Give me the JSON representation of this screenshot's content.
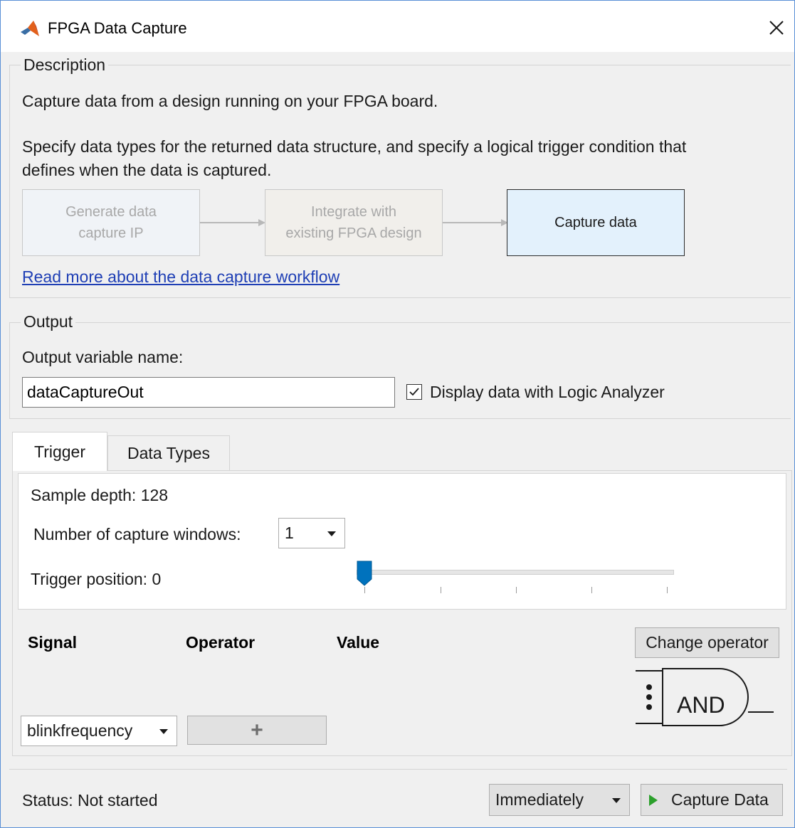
{
  "window": {
    "title": "FPGA Data Capture",
    "close_label": "×"
  },
  "description": {
    "group_label": "Description",
    "line1": "Capture data from a design running on your FPGA board.",
    "line2": "Specify data types for the returned data structure, and specify a logical trigger condition that",
    "line3": "defines when the data is captured.",
    "flow": [
      {
        "line1": "Generate data",
        "line2": "capture IP"
      },
      {
        "line1": "Integrate with",
        "line2": "existing FPGA design"
      },
      {
        "line1": "Capture data",
        "line2": ""
      }
    ],
    "link": "Read more about the data capture workflow"
  },
  "output": {
    "group_label": "Output",
    "var_label": "Output variable name:",
    "var_value": "dataCaptureOut",
    "checkbox_label": "Display data with Logic Analyzer",
    "checkbox_checked": true
  },
  "tabs": [
    {
      "label": "Trigger",
      "active": true
    },
    {
      "label": "Data Types",
      "active": false
    }
  ],
  "trigger": {
    "sample_depth": "Sample depth: 128",
    "windows_label": "Number of capture windows:",
    "windows_value": "1",
    "position_label": "Trigger position: 0",
    "position_value": 0,
    "table_headers": {
      "signal": "Signal",
      "operator": "Operator",
      "value": "Value"
    },
    "signal_select": "blinkfrequency",
    "add_label": "+",
    "change_operator_label": "Change operator",
    "gate_label": "AND"
  },
  "status": {
    "text": "Status: Not started",
    "mode_value": "Immediately",
    "capture_label": "Capture Data"
  },
  "colors": {
    "accent": "#0072bd",
    "link": "#1f3fb5",
    "active_flow": "#e3f1fc",
    "play_green": "#2ca02c"
  }
}
